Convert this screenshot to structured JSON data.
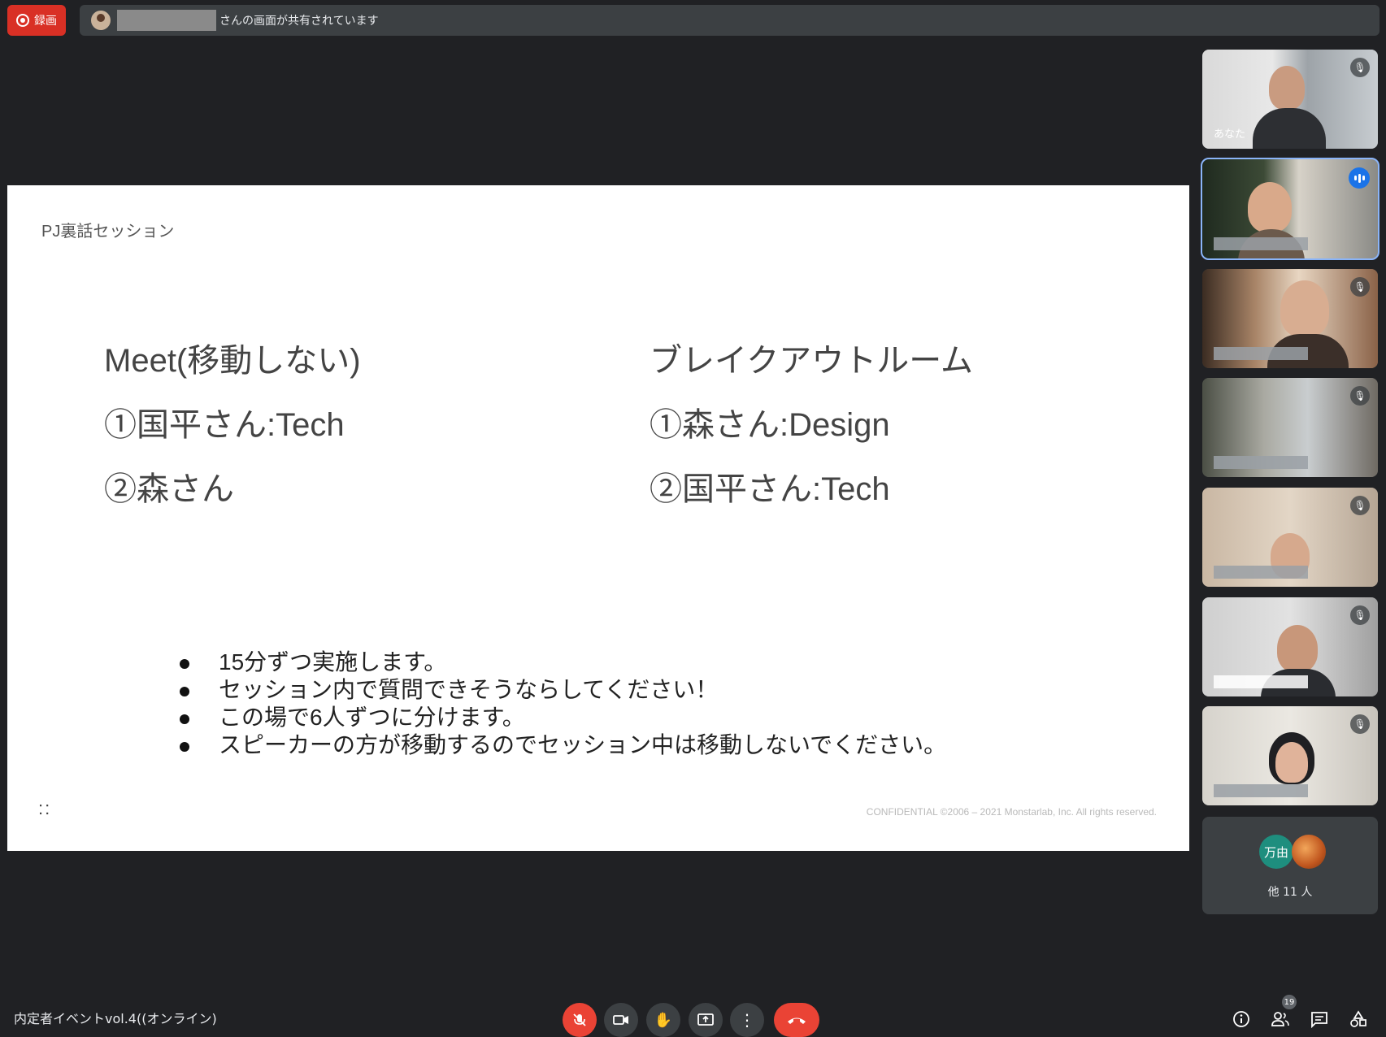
{
  "top_bar": {
    "record_label": "録画",
    "share_message": "さんの画面が共有されています"
  },
  "slide": {
    "title": "PJ裏話セッション",
    "left_column": {
      "heading": "Meet(移動しない)",
      "items": [
        "①国平さん:Tech",
        "②森さん"
      ]
    },
    "right_column": {
      "heading": "ブレイクアウトルーム",
      "items": [
        "①森さん:Design",
        "②国平さん:Tech"
      ]
    },
    "bullets": [
      "15分ずつ実施します。",
      "セッション内で質問できそうならしてください！",
      "この場で6人ずつに分けます。",
      "スピーカーの方が移動するのでセッション中は移動しないでください。"
    ],
    "logo_mark": "::",
    "confidential": "CONFIDENTIAL ©2006 – 2021 Monstarlab, Inc. All rights reserved."
  },
  "participants": {
    "self_label": "あなた",
    "others_avatar_text": "万由",
    "others_label": "他 11 人"
  },
  "bottom_bar": {
    "meeting_title": "内定者イベントvol.4((オンライン)",
    "participant_count": "19"
  },
  "colors": {
    "background": "#202124",
    "record_red": "#d93025",
    "hangup_red": "#ea4335",
    "active_speaker_outline": "#8ab4f8",
    "slide_background": "#ffffff"
  },
  "icons": {
    "record": "record-icon",
    "mic_off": "mic-off-icon",
    "camera": "camera-icon",
    "raise_hand": "raise-hand-icon",
    "present": "present-screen-icon",
    "more": "more-options-icon",
    "hangup": "hangup-icon",
    "info": "info-icon",
    "people": "people-icon",
    "chat": "chat-icon",
    "activities": "activities-icon"
  }
}
